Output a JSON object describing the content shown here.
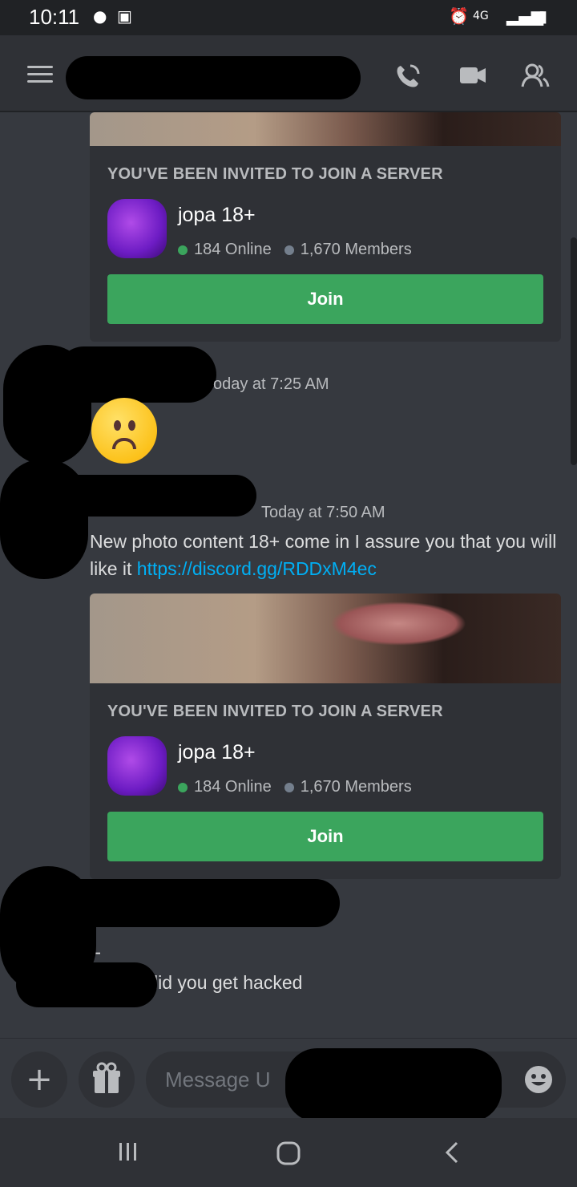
{
  "status_bar": {
    "time": "10:11",
    "network": "4G"
  },
  "header": {
    "channel_name": ""
  },
  "invites": [
    {
      "title": "YOU'VE BEEN INVITED TO JOIN A SERVER",
      "server_name": "jopa 18+",
      "online": "184 Online",
      "members": "1,670 Members",
      "join_label": "Join"
    },
    {
      "title": "YOU'VE BEEN INVITED TO JOIN A SERVER",
      "server_name": "jopa 18+",
      "online": "184 Online",
      "members": "1,670 Members",
      "join_label": "Join"
    }
  ],
  "messages": [
    {
      "timestamp": "oday at 7:25 AM"
    },
    {
      "timestamp": "Today at 7:50 AM",
      "text": "New photo content 18+ come in I assure you that you will like it ",
      "link": "https://discord.gg/RDDxM4ec"
    },
    {
      "line1": "I-",
      "line2": "lid you get hacked"
    }
  ],
  "composer": {
    "placeholder": "Message U"
  },
  "colors": {
    "join": "#3ba55d",
    "online_dot": "#3ba55d",
    "member_dot": "#747f8d",
    "link": "#00aff4"
  }
}
